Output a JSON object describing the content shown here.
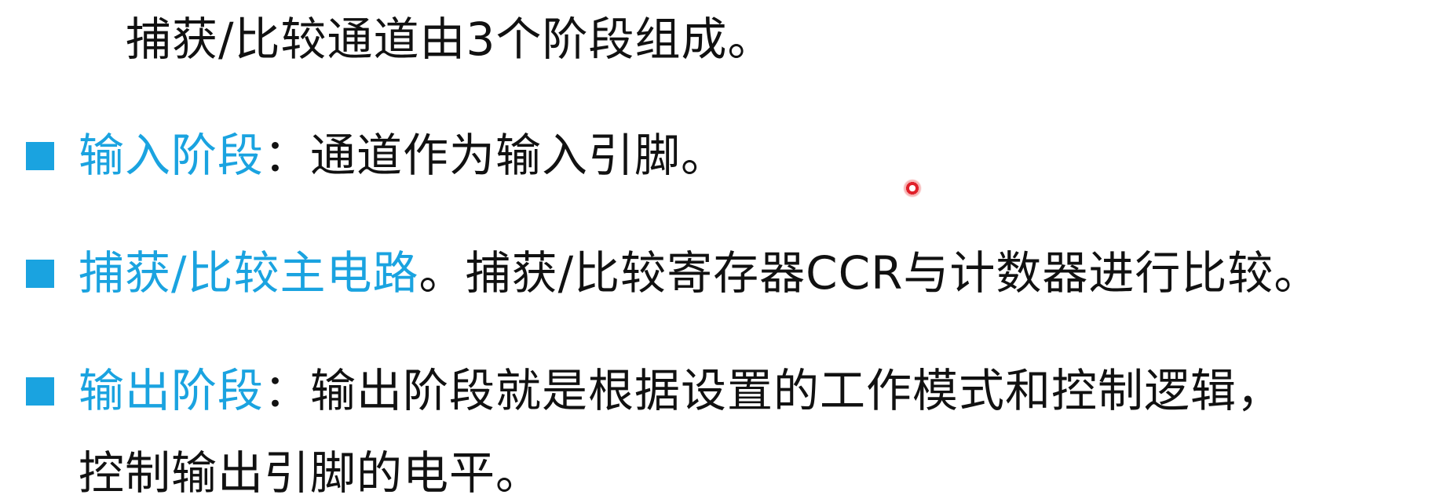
{
  "intro": "捕获/比较通道由3个阶段组成。",
  "items": [
    {
      "term": "输入阶段",
      "separator": "：",
      "text": "通道作为输入引脚。"
    },
    {
      "term": "捕获/比较主电路",
      "separator": "。",
      "text": "捕获/比较寄存器CCR与计数器进行比较。"
    },
    {
      "term": "输出阶段",
      "separator": "：",
      "text": "输出阶段就是根据设置的工作模式和控制逻辑，"
    }
  ],
  "continuation": "控制输出引脚的电平。",
  "colors": {
    "accent": "#1aa3e0",
    "text": "#111111",
    "pointer": "#e0202a"
  }
}
